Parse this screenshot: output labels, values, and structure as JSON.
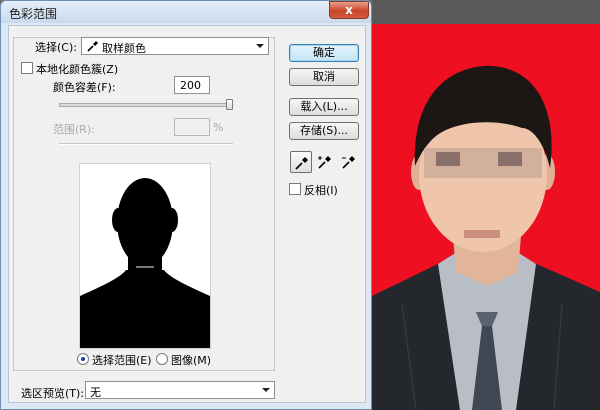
{
  "window": {
    "title": "色彩范围",
    "close_glyph": "x"
  },
  "select_row": {
    "label": "选择(C):",
    "value": "取样颜色",
    "icon": "eyedropper-icon"
  },
  "localized": {
    "label": "本地化颜色簇(Z)",
    "checked": false
  },
  "fuzziness": {
    "label": "颜色容差(F):",
    "value": "200",
    "slider_fraction": 1.0
  },
  "range": {
    "label": "范围(R):",
    "unit": "%",
    "value": "",
    "enabled": false
  },
  "preview_mode": {
    "options": [
      {
        "label": "选择范围(E)",
        "selected": true
      },
      {
        "label": "图像(M)",
        "selected": false
      }
    ]
  },
  "selection_preview": {
    "label": "选区预览(T):",
    "value": "无"
  },
  "buttons": {
    "ok": "确定",
    "cancel": "取消",
    "load": "载入(L)...",
    "save": "存储(S)..."
  },
  "tools": [
    {
      "name": "eyedropper-icon",
      "active": true
    },
    {
      "name": "eyedropper-plus-icon",
      "active": false
    },
    {
      "name": "eyedropper-minus-icon",
      "active": false
    }
  ],
  "invert": {
    "label": "反相(I)",
    "checked": false
  },
  "colors": {
    "photo_background": "#ee0f20",
    "dialog_frame": "#dde8f5",
    "client": "#f0f0f0",
    "mask": "#000000"
  }
}
